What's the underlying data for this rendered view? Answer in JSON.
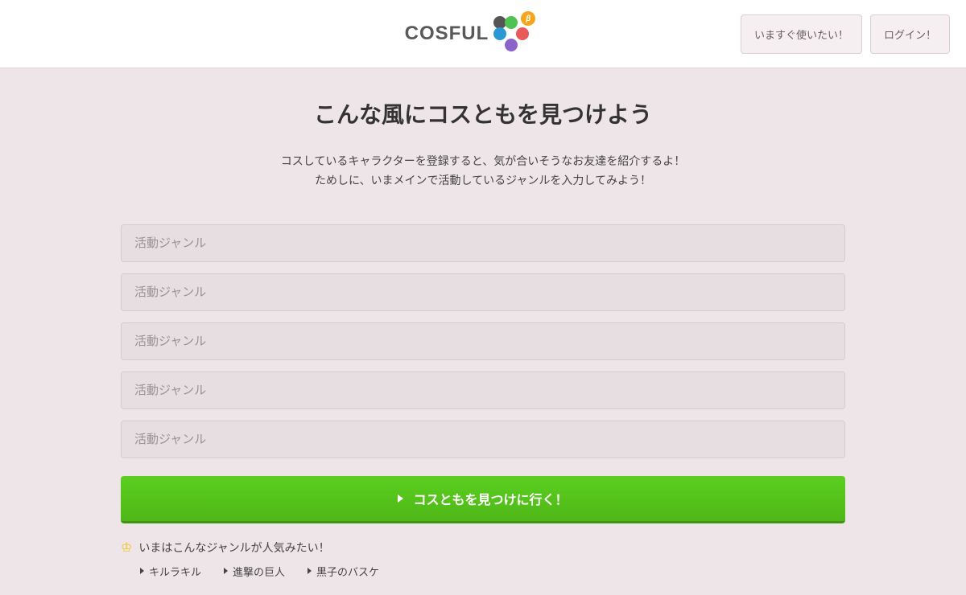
{
  "logo": {
    "text": "COSFUL",
    "beta": "β"
  },
  "header": {
    "useNowButton": "いますぐ使いたい！",
    "loginButton": "ログイン！"
  },
  "main": {
    "title": "こんな風にコスともを見つけよう",
    "descLine1": "コスしているキャラクターを登録すると、気が合いそうなお友達を紹介するよ！",
    "descLine2": "ためしに、いまメインで活動しているジャンルを入力してみよう！",
    "inputPlaceholder": "活動ジャンル",
    "submitLabel": "コスともを見つけに行く！"
  },
  "popular": {
    "heading": "いまはこんなジャンルが人気みたい！",
    "items": [
      "キルラキル",
      "進撃の巨人",
      "黒子のバスケ"
    ]
  }
}
